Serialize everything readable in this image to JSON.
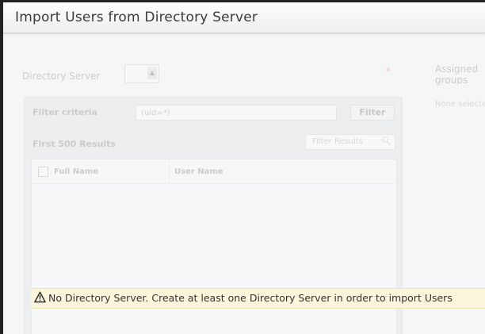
{
  "dialog": {
    "title": "Import Users from Directory Server"
  },
  "form": {
    "directory_server_label": "Directory Server",
    "required_marker": "*",
    "assigned_groups_label_line1": "Assigned",
    "assigned_groups_label_line2": "groups",
    "assigned_groups_empty": "None selected",
    "filter_criteria_label": "Filter criteria",
    "filter_criteria_value": "(uid=*)",
    "filter_button_label": "Filter",
    "results_label": "First 500 Results",
    "filter_results_placeholder": "Filter Results",
    "search_icon": "magnifier-icon"
  },
  "table": {
    "columns": [
      "Full Name",
      "User Name"
    ]
  },
  "warning": {
    "icon": "warning-triangle-icon",
    "message": "No Directory Server. Create at least one Directory Server in order to import Users",
    "background": "#fbf5dc"
  }
}
